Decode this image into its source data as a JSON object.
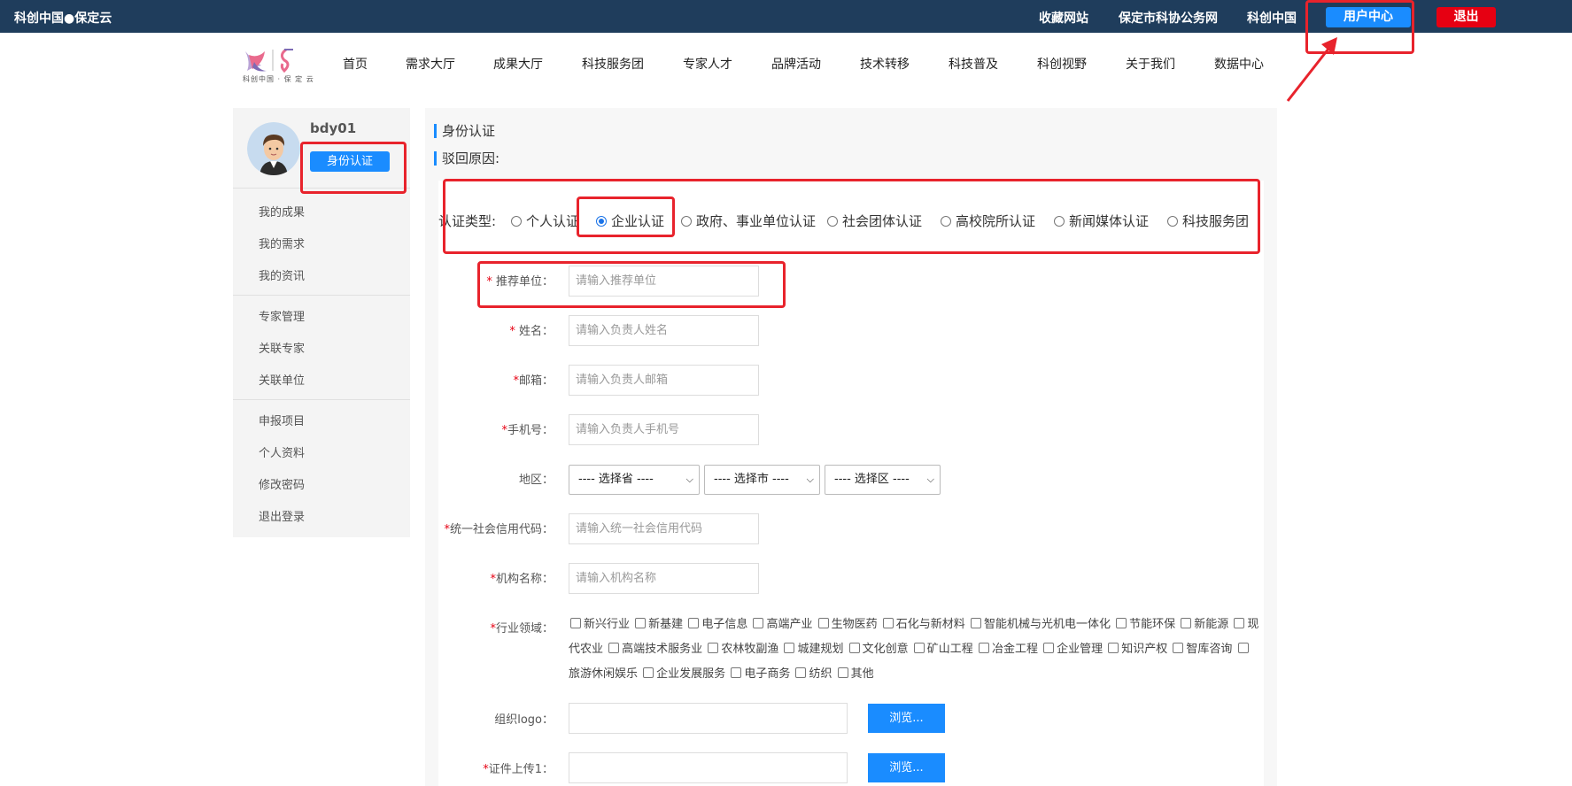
{
  "topbar": {
    "site_name": "科创中国●保定云",
    "links": [
      "收藏网站",
      "保定市科协公务网",
      "科创中国"
    ],
    "user_center": "用户中心",
    "logout": "退出"
  },
  "logo": {
    "text": "科创中国 · 保 定 云"
  },
  "nav": [
    "首页",
    "需求大厅",
    "成果大厅",
    "科技服务团",
    "专家人才",
    "品牌活动",
    "技术转移",
    "科技普及",
    "科创视野",
    "关于我们",
    "数据中心"
  ],
  "sidebar": {
    "username": "bdy01",
    "auth_button": "身份认证",
    "group1": [
      "我的成果",
      "我的需求",
      "我的资讯"
    ],
    "group2": [
      "专家管理",
      "关联专家",
      "关联单位"
    ],
    "group3": [
      "申报项目",
      "个人资料",
      "修改密码",
      "退出登录"
    ]
  },
  "main": {
    "title": "身份认证",
    "reject_reason": "驳回原因:",
    "auth_type_label": "认证类型:",
    "auth_types": [
      "个人认证",
      "企业认证",
      "政府、事业单位认证",
      "社会团体认证",
      "高校院所认证",
      "新闻媒体认证",
      "科技服务团"
    ],
    "selected_type": "企业认证"
  },
  "form": {
    "recommend_unit": {
      "label": "推荐单位：",
      "placeholder": "请输入推荐单位"
    },
    "name": {
      "label": "姓名：",
      "placeholder": "请输入负责人姓名"
    },
    "email": {
      "label": "邮箱：",
      "placeholder": "请输入负责人邮箱"
    },
    "phone": {
      "label": "手机号：",
      "placeholder": "请输入负责人手机号"
    },
    "region": {
      "label": "地区：",
      "province": "---- 选择省 ----",
      "city": "---- 选择市 ----",
      "district": "---- 选择区 ----"
    },
    "credit_code": {
      "label": "统一社会信用代码：",
      "placeholder": "请输入统一社会信用代码"
    },
    "org_name": {
      "label": "机构名称：",
      "placeholder": "请输入机构名称"
    },
    "industry": {
      "label": "行业领域：",
      "options": [
        "新兴行业",
        "新基建",
        "电子信息",
        "高端产业",
        "生物医药",
        "石化与新材料",
        "智能机械与光机电一体化",
        "节能环保",
        "新能源",
        "现代农业",
        "高端技术服务业",
        "农林牧副渔",
        "城建规划",
        "文化创意",
        "矿山工程",
        "冶金工程",
        "企业管理",
        "知识产权",
        "智库咨询",
        "旅游休闲娱乐",
        "企业发展服务",
        "电子商务",
        "纺织",
        "其他"
      ]
    },
    "org_logo": {
      "label": "组织logo："
    },
    "cert1": {
      "label": "证件上传1："
    },
    "browse": "浏览..."
  }
}
